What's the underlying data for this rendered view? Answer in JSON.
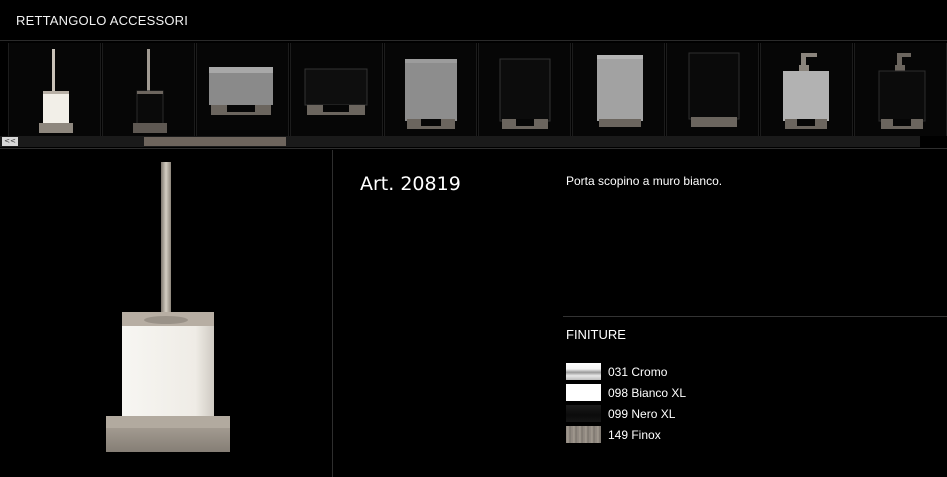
{
  "header": {
    "title": "RETTANGOLO ACCESSORI"
  },
  "thumbnails": [
    {
      "name": "toilet-brush-white"
    },
    {
      "name": "toilet-brush-black"
    },
    {
      "name": "soap-dish-white"
    },
    {
      "name": "soap-dish-black"
    },
    {
      "name": "tumbler-white"
    },
    {
      "name": "tumbler-black"
    },
    {
      "name": "tumbler-tall-white"
    },
    {
      "name": "tumbler-tall-black"
    },
    {
      "name": "soap-dispenser-white"
    },
    {
      "name": "soap-dispenser-black"
    }
  ],
  "scroll": {
    "left_label": "<<"
  },
  "product": {
    "article": "Art. 20819",
    "description": "Porta scopino a muro bianco."
  },
  "finiture": {
    "title": "FINITURE",
    "items": [
      {
        "label": "031 Cromo",
        "swatch": "cromo"
      },
      {
        "label": "098 Bianco XL",
        "swatch": "bianco"
      },
      {
        "label": "099 Nero XL",
        "swatch": "nero"
      },
      {
        "label": "149 Finox",
        "swatch": "finox"
      }
    ]
  },
  "colors": {
    "background": "#000000",
    "metal": "#a59d93",
    "scroll_thumb": "#6e655d"
  }
}
